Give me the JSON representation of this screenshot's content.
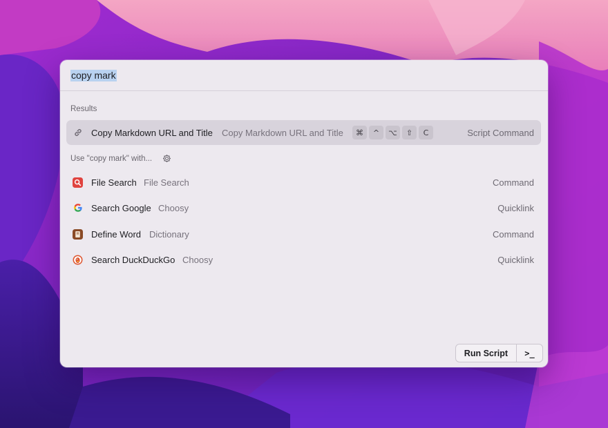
{
  "search": {
    "value": "copy mark"
  },
  "sections": {
    "results": "Results",
    "use_with": "Use \"copy mark\" with..."
  },
  "selected_result": {
    "title": "Copy Markdown URL and Title",
    "subtitle": "Copy Markdown URL and Title",
    "shortcut_keys": [
      "⌘",
      "^",
      "⌥",
      "⇧",
      "C"
    ],
    "accessory": "Script Command",
    "icon": "link-icon"
  },
  "fallback_items": [
    {
      "title": "File Search",
      "subtitle": "File Search",
      "accessory": "Command",
      "icon": "file-search-icon",
      "color": "#e0433f"
    },
    {
      "title": "Search Google",
      "subtitle": "Choosy",
      "accessory": "Quicklink",
      "icon": "google-icon",
      "color": "#4285f4"
    },
    {
      "title": "Define Word",
      "subtitle": "Dictionary",
      "accessory": "Command",
      "icon": "dictionary-icon",
      "color": "#8a4a26"
    },
    {
      "title": "Search DuckDuckGo",
      "subtitle": "Choosy",
      "accessory": "Quicklink",
      "icon": "duckduckgo-icon",
      "color": "#de5833"
    }
  ],
  "footer": {
    "primary_action": "Run Script",
    "secondary_action": ">_"
  }
}
